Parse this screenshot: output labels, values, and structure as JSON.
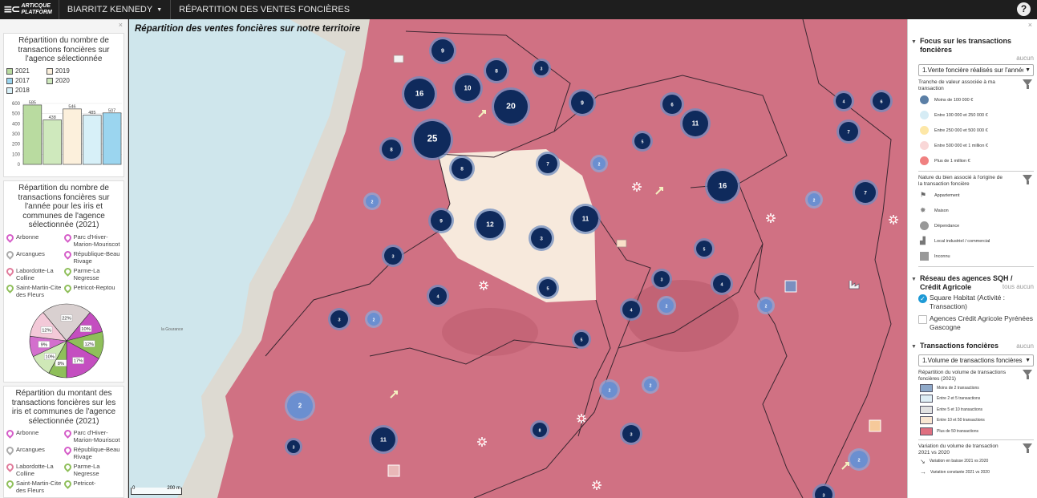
{
  "topbar": {
    "logo_mark": "≡⊂",
    "logo_line1": "ARTICQUE",
    "logo_line2": "PLATFORM",
    "agency": "BIARRITZ KENNEDY",
    "tab_title": "RÉPARTITION DES VENTES FONCIÈRES",
    "help": "?"
  },
  "left": {
    "close": "×",
    "chart1": {
      "title": "Répartition du nombre de transactions foncières sur l'agence sélectionnée",
      "legend": [
        {
          "label": "2021",
          "color": "#b9dba0"
        },
        {
          "label": "2019",
          "color": "#fcf0dc"
        },
        {
          "label": "2017",
          "color": "#9bd5ef"
        },
        {
          "label": "2020",
          "color": "#cfe9bd"
        },
        {
          "label": "2018",
          "color": "#d7f0f8"
        }
      ]
    },
    "chart2": {
      "title": "Répartition du nombre de transactions foncières sur l'année pour les iris et communes de l'agence sélectionnée (2021)",
      "items": [
        "Arbonne",
        "Parc d'Hiver-Marion-Mouriscot",
        "Arcangues",
        "République-Beau Rivage",
        "Labordotte-La Colline",
        "Parme-La Negresse",
        "Saint-Martin-Cite des Fleurs",
        "Petricot-Reptou"
      ]
    },
    "chart3": {
      "title": "Répartition du montant des transactions foncières sur les iris et communes de l'agence sélectionnée (2021)",
      "items": [
        "Arbonne",
        "Parc d'Hiver-Marion-Mouriscot",
        "Arcangues",
        "République-Beau Rivage",
        "Labordotte-La Colline",
        "Parme-La Negresse",
        "Saint-Martin-Cite des Fleurs",
        "Petricot-"
      ]
    }
  },
  "chart_data": [
    {
      "type": "bar",
      "categories": [
        "2021",
        "2020",
        "2019",
        "2018",
        "2017"
      ],
      "values": [
        585,
        438,
        546,
        485,
        507
      ],
      "colors": [
        "#b9dba0",
        "#cfe9bd",
        "#fcf0dc",
        "#d7f0f8",
        "#9bd5ef"
      ],
      "ylim": [
        0,
        600
      ],
      "yticks": [
        0,
        100,
        200,
        300,
        400,
        500,
        600
      ],
      "grid": true
    },
    {
      "type": "pie",
      "labels": [
        "",
        "",
        "",
        "",
        "",
        "",
        "",
        ""
      ],
      "values": [
        22,
        10,
        12,
        17,
        8,
        10,
        9,
        12
      ],
      "value_labels": [
        "22%",
        "10%",
        "12%",
        "17%",
        "8%",
        "10%",
        "9%",
        "12%"
      ],
      "colors": [
        "#d9d0d0",
        "#c44ec0",
        "#8fbf5a",
        "#c44ec0",
        "#8fbf5a",
        "#cfe8b7",
        "#d36fcd",
        "#f3c9d8"
      ]
    }
  ],
  "map": {
    "title": "Répartition des ventes foncières sur notre territoire",
    "scale_label": "200 m",
    "scale_zero": "0",
    "place_label": "la Gourance",
    "clusters": [
      "9",
      "8",
      "3",
      "16",
      "10",
      "20",
      "9",
      "6",
      "11",
      "4",
      "6",
      "25",
      "8",
      "7",
      "7",
      "5",
      "8",
      "2",
      "2",
      "16",
      "2",
      "7",
      "9",
      "12",
      "3",
      "11",
      "3",
      "5",
      "5",
      "4",
      "2",
      "4",
      "3",
      "2",
      "3",
      "4",
      "2",
      "5",
      "2",
      "2",
      "11",
      "8",
      "3",
      "3",
      "2",
      "3",
      "2"
    ]
  },
  "right": {
    "close": "×",
    "focus": {
      "title": "Focus sur les transactions foncières",
      "aside": "aucun",
      "select": "1.Vente foncière réalisés sur l'année",
      "value_title": "Tranche de valeur associée à ma transaction",
      "value_items": [
        {
          "label": "Moins de 100 000 €",
          "color": "#5b7fa6"
        },
        {
          "label": "Entre 100 000 et 250 000 €",
          "color": "#d6ecf5"
        },
        {
          "label": "Entre 250 000 et 500 000 €",
          "color": "#fde7a7"
        },
        {
          "label": "Entre 500 000 et 1 million €",
          "color": "#f9d7d7"
        },
        {
          "label": "Plus de 1 million €",
          "color": "#f08080"
        }
      ],
      "nature_title": "Nature du bien associé à l'origine de la transaction foncière",
      "nature_items": [
        {
          "label": "Appartement",
          "icon": "flag-icon"
        },
        {
          "label": "Maison",
          "icon": "gear-icon"
        },
        {
          "label": "Dépendance",
          "icon": "circle-icon"
        },
        {
          "label": "Local industriel / commercial",
          "icon": "factory-icon"
        },
        {
          "label": "Inconnu",
          "icon": "square-icon"
        }
      ]
    },
    "network": {
      "title": "Réseau des agences SQH / Crédit Agricole",
      "aside": "tous  aucun",
      "items": [
        {
          "label": "Square Habitat (Activité : Transaction)",
          "checked": true
        },
        {
          "label": "Agences Crédit Agricole Pyrénées Gascogne",
          "checked": false
        }
      ]
    },
    "transactions": {
      "title": "Transactions foncières",
      "aside": "aucun",
      "select": "1.Volume de transactions foncières",
      "vol_title": "Répartition du volume de transactions foncières (2021)",
      "vol_items": [
        {
          "label": "Moins de 2 transactions",
          "color": "#8fa9c9"
        },
        {
          "label": "Entre 2 et 5 transactions",
          "color": "#dfeef5"
        },
        {
          "label": "Entre 5 et 10 transactions",
          "color": "#e2e2e2"
        },
        {
          "label": "Entre 10 et 50 transactions",
          "color": "#f8e6d2"
        },
        {
          "label": "Plus de 50 transactions",
          "color": "#df6f80"
        }
      ],
      "var_title": "Variation du volume de transaction 2021 vs 2020",
      "var_items": [
        "Variation en baisse 2021 vs 2020",
        "Variation constante 2021 vs 2020"
      ]
    }
  }
}
